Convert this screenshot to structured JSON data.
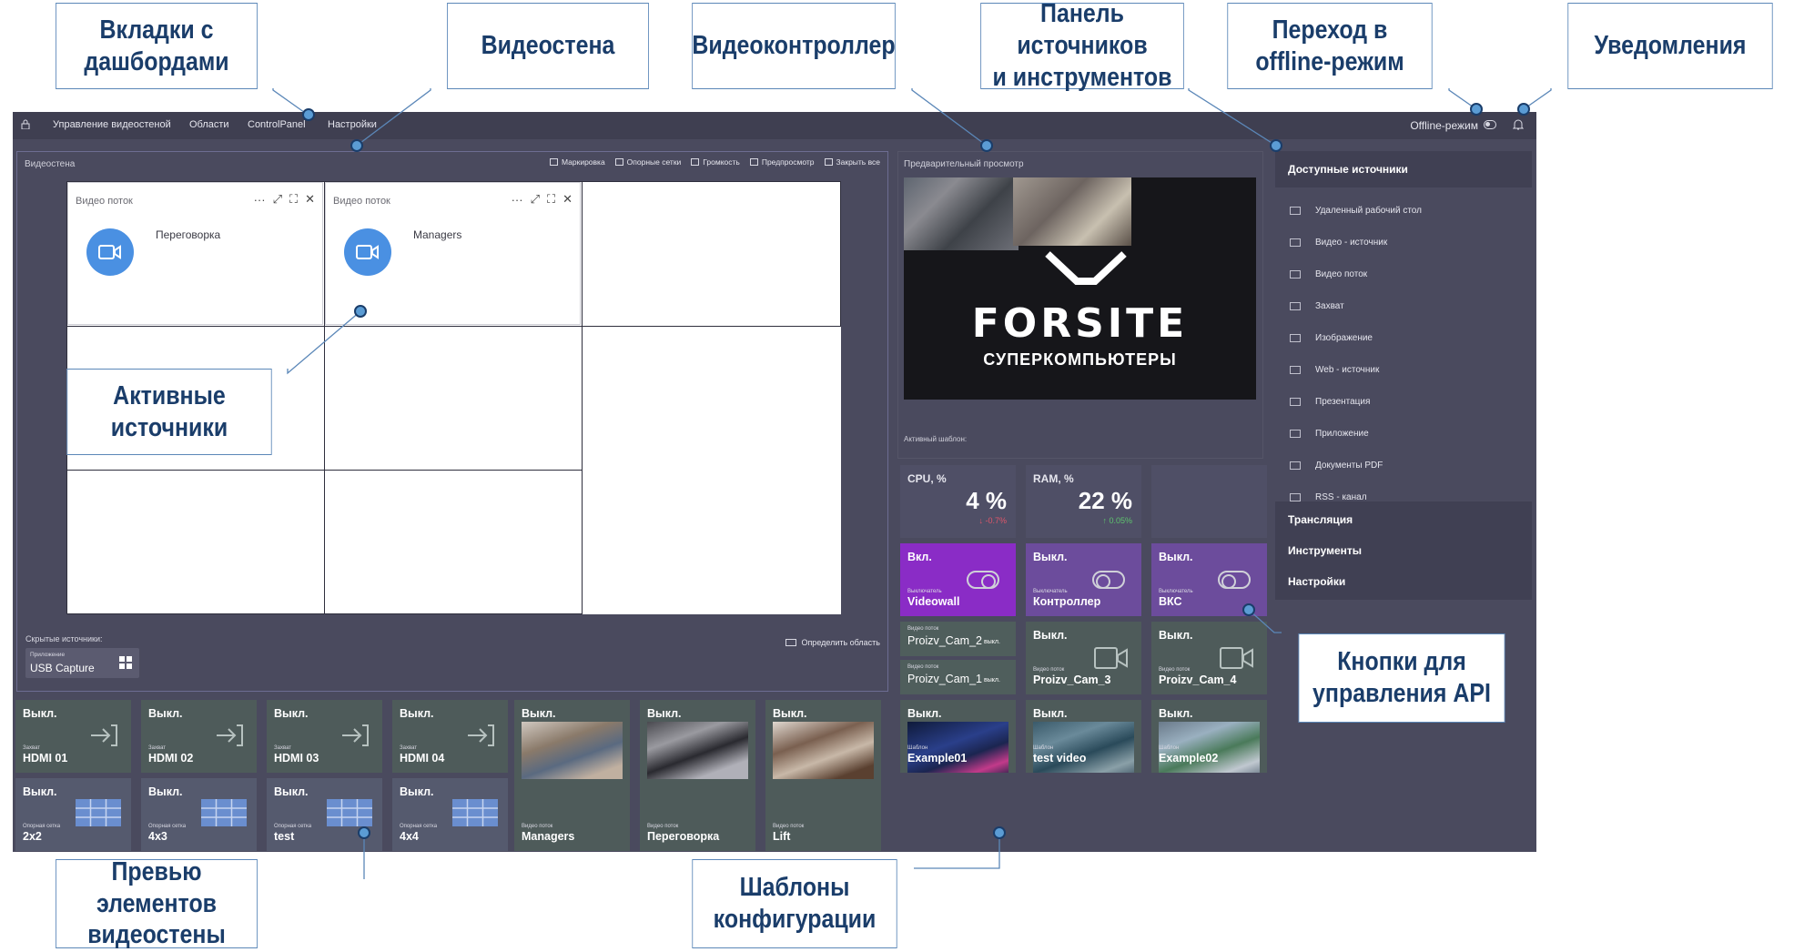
{
  "topbar": {
    "tabs": [
      "Управление видеостеной",
      "Области",
      "ControlPanel",
      "Настройки"
    ],
    "offline_label": "Offline-режим"
  },
  "wall": {
    "title": "Видеостена",
    "toolbar": [
      "Маркировка",
      "Опорные сетки",
      "Громкость",
      "Предпросмотр",
      "Закрыть все"
    ],
    "active_sources": [
      {
        "title": "Видео поток",
        "name": "Переговорка",
        "tools": "···"
      },
      {
        "title": "Видео поток",
        "name": "Managers",
        "tools": "···"
      }
    ],
    "hidden_label": "Скрытые источники:",
    "hidden_source": {
      "kind": "Приложение",
      "name": "USB Capture"
    },
    "define_area": "Определить область"
  },
  "preview": {
    "title": "Предварительный просмотр",
    "brand": "FORSITE",
    "brand_sub": "СУПЕРКОМПЬЮТЕРЫ",
    "active_template": "Активный шаблон:"
  },
  "metrics": [
    {
      "label": "CPU, %",
      "value": "4 %",
      "delta": "↓ -0.7%",
      "delta_color": "#e0566a"
    },
    {
      "label": "RAM, %",
      "value": "22 %",
      "delta": "↑ 0.05%",
      "delta_color": "#5ec46e"
    }
  ],
  "api_buttons": [
    {
      "state": "Вкл.",
      "kind": "Выключатель",
      "name": "Videowall",
      "on": true
    },
    {
      "state": "Выкл.",
      "kind": "Выключатель",
      "name": "Контроллер",
      "on": false
    },
    {
      "state": "Выкл.",
      "kind": "Выключатель",
      "name": "ВКС",
      "on": false
    }
  ],
  "stream_half": [
    {
      "kind": "Видео поток",
      "name": "Proizv_Cam_2",
      "ext": "выкл."
    },
    {
      "kind": "Видео поток",
      "name": "Proizv_Cam_1",
      "ext": "выкл."
    }
  ],
  "stream_tiles": [
    {
      "state": "Выкл.",
      "kind": "Видео поток",
      "name": "Proizv_Cam_3"
    },
    {
      "state": "Выкл.",
      "kind": "Видео поток",
      "name": "Proizv_Cam_4"
    }
  ],
  "bottom_row1": [
    {
      "state": "Выкл.",
      "kind": "Захват",
      "name": "HDMI 01"
    },
    {
      "state": "Выкл.",
      "kind": "Захват",
      "name": "HDMI 02"
    },
    {
      "state": "Выкл.",
      "kind": "Захват",
      "name": "HDMI 03"
    },
    {
      "state": "Выкл.",
      "kind": "Захват",
      "name": "HDMI 04"
    }
  ],
  "bottom_row2": [
    {
      "state": "Выкл.",
      "kind": "Опорная сетка",
      "name": "2x2"
    },
    {
      "state": "Выкл.",
      "kind": "Опорная сетка",
      "name": "4x3"
    },
    {
      "state": "Выкл.",
      "kind": "Опорная сетка",
      "name": "test"
    },
    {
      "state": "Выкл.",
      "kind": "Опорная сетка",
      "name": "4x4"
    }
  ],
  "bottom_streams": [
    {
      "state": "Выкл.",
      "kind": "Видео поток",
      "name": "Managers"
    },
    {
      "state": "Выкл.",
      "kind": "Видео поток",
      "name": "Переговорка"
    },
    {
      "state": "Выкл.",
      "kind": "Видео поток",
      "name": "Lift"
    }
  ],
  "templates": [
    {
      "state": "Выкл.",
      "kind": "Шаблон",
      "name": "Example01"
    },
    {
      "state": "Выкл.",
      "kind": "Шаблон",
      "name": "test video"
    },
    {
      "state": "Выкл.",
      "kind": "Шаблон",
      "name": "Example02"
    }
  ],
  "sidebar": {
    "available_title": "Доступные источники",
    "items": [
      "Удаленный рабочий стол",
      "Видео - источник",
      "Видео поток",
      "Захват",
      "Изображение",
      "Web - источник",
      "Презентация",
      "Приложение",
      "Документы PDF",
      "RSS - канал"
    ],
    "sections": [
      "Трансляция",
      "Инструменты",
      "Настройки"
    ]
  },
  "annotations": {
    "tabs": [
      "Вкладки с",
      "дашбордами"
    ],
    "videowall": [
      "Видеостена"
    ],
    "controller": [
      "Видеоконтроллер"
    ],
    "panel": [
      "Панель источников",
      "и инструментов"
    ],
    "offline": [
      "Переход в",
      "offline-режим"
    ],
    "notifications": [
      "Уведомления"
    ],
    "active": [
      "Активные источники"
    ],
    "api": [
      "Кнопки для",
      "управления API"
    ],
    "preview": [
      "Превью элементов",
      "видеостены"
    ],
    "templates": [
      "Шаблоны",
      "конфигурации"
    ]
  }
}
